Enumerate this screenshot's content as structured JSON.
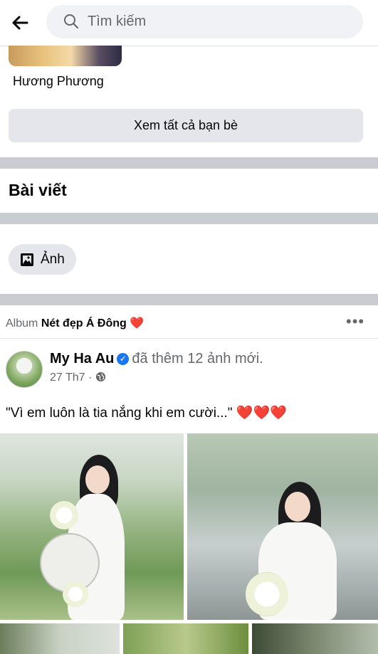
{
  "search": {
    "placeholder": "Tìm kiếm"
  },
  "friends": {
    "last_friend_name": "Hương Phương",
    "see_all_label": "Xem tất cả bạn bè"
  },
  "posts_section": {
    "title": "Bài viết",
    "photos_filter_label": "Ảnh"
  },
  "post": {
    "album_prefix": "Album",
    "album_name": "Nét đẹp Á Đông",
    "album_heart": "❤️",
    "author": "My Ha Au",
    "action": "đã thêm 12 ảnh mới.",
    "date": "27 Th7",
    "separator": "·",
    "caption": "\"Vì em luôn là tia nắng khi em cười...\" ❤️❤️❤️",
    "more_label": "•••"
  },
  "colors": {
    "separator": "#c9ccd1",
    "button_bg": "#e4e6eb",
    "secondary_text": "#65676b",
    "verified": "#1877f2",
    "heart": "#e41e3f"
  }
}
